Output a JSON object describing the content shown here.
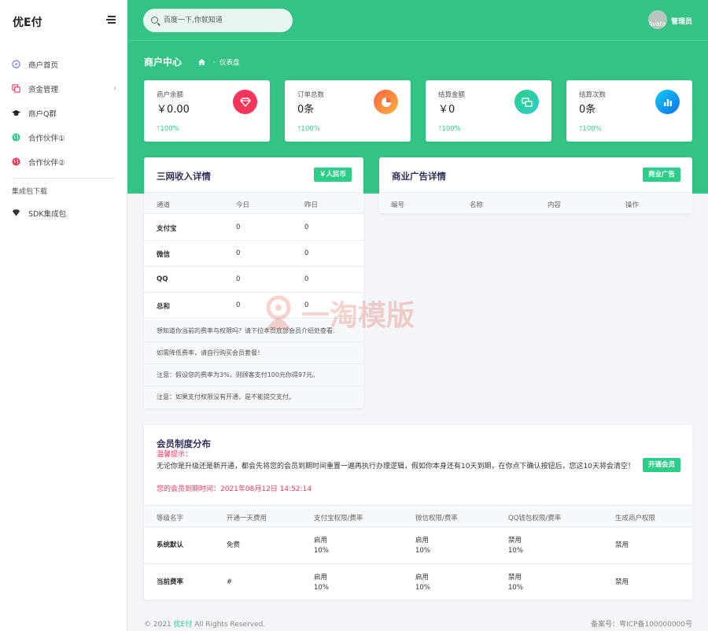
{
  "brand": "优E付",
  "sidebar": {
    "items": [
      {
        "label": "商户首页",
        "icon": "compass-icon"
      },
      {
        "label": "资金管理",
        "icon": "copy-icon"
      },
      {
        "label": "商户Q群",
        "icon": "graduation-cap-icon"
      },
      {
        "label": "合作伙伴①",
        "icon": "globe-icon"
      },
      {
        "label": "合作伙伴②",
        "icon": "globe-icon"
      }
    ],
    "section_label": "集成包下载",
    "sdk": {
      "label": "SDK集成包",
      "icon": "diamond-icon"
    }
  },
  "search": {
    "placeholder": "百度一下,你就知道"
  },
  "user": {
    "avatar_alt": "Avatar",
    "name": "管理员"
  },
  "page": {
    "title": "商户中心",
    "breadcrumb": "仪表盘"
  },
  "stats": [
    {
      "label": "商户余额",
      "value": "￥0.00",
      "change": "100%",
      "icon": "diamond-icon",
      "color": "#f5365c"
    },
    {
      "label": "订单总数",
      "value": "0条",
      "change": "100%",
      "icon": "pie-chart-icon",
      "color": "#fb6340"
    },
    {
      "label": "结算金额",
      "value": "￥0",
      "change": "100%",
      "icon": "money-icon",
      "color": "#2dce89"
    },
    {
      "label": "结算次数",
      "value": "0条",
      "change": "100%",
      "icon": "bar-chart-icon",
      "color": "#11cdef"
    }
  ],
  "income": {
    "title": "三网收入详情",
    "tag": "￥人民币",
    "headers": [
      "通道",
      "今日",
      "昨日"
    ],
    "rows": [
      [
        "支付宝",
        "0",
        "0"
      ],
      [
        "微信",
        "0",
        "0"
      ],
      [
        "QQ",
        "0",
        "0"
      ],
      [
        "总和",
        "0",
        "0"
      ]
    ],
    "notes": [
      "想知道你当前的费率与权限吗？请下拉本页底部会员介绍处查看.",
      "如需降低费率，请自行购买会员套餐！",
      "注意：假设您的费率为3%，则顾客支付100元你得97元。",
      "注意：如果支付权限没有开通，是不能提交支付。"
    ]
  },
  "ads": {
    "title": "商业广告详情",
    "tag": "商业广告",
    "headers": [
      "编号",
      "名称",
      "内容",
      "操作"
    ]
  },
  "watermark": "一淘模版",
  "membership": {
    "title": "会员制度分布",
    "tip_label": "温馨提示：",
    "tip_text": "无论你是升级还是新开通，都会先将您的会员到期时间重置一遍再执行办理逻辑，假如你本身还有10天到期，在你点下确认按钮后，您这10天将会清空！",
    "expiry": "您的会员到期时间：2021年08月12日 14:52:14",
    "button": "开通会员",
    "headers": [
      "等级名字",
      "开通一天费用",
      "支付宝权限/费率",
      "微信权限/费率",
      "QQ钱包权限/费率",
      "生成商户权限"
    ],
    "rows": [
      {
        "name": "系统默认",
        "fee": "免费",
        "alipay": [
          "启用",
          "10%"
        ],
        "wechat": [
          "启用",
          "10%"
        ],
        "qq": [
          "禁用",
          "10%"
        ],
        "merchant": "禁用"
      },
      {
        "name": "当前费率",
        "fee": "#",
        "alipay": [
          "启用",
          "10%"
        ],
        "wechat": [
          "启用",
          "10%"
        ],
        "qq": [
          "禁用",
          "10%"
        ],
        "merchant": "禁用"
      }
    ]
  },
  "footer": {
    "copyright_pre": "© 2021",
    "brand": "优E付",
    "copyright_post": "All Rights Reserved.",
    "icp": "备案号：粤ICP备100000000号"
  },
  "colors": {
    "primary": "#33c384",
    "accent": "#2dce89"
  }
}
